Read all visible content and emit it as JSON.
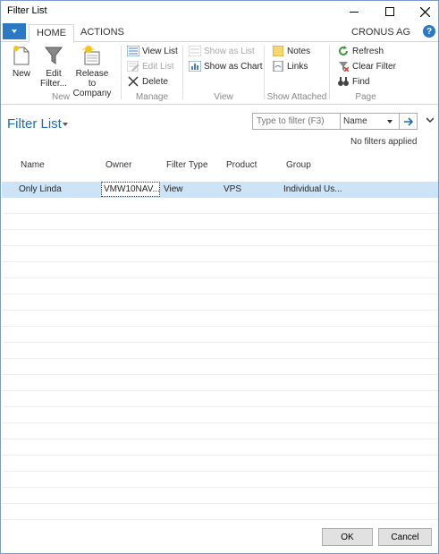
{
  "window": {
    "title": "Filter List"
  },
  "ribbon_tabs": {
    "home": "HOME",
    "actions": "ACTIONS",
    "company": "CRONUS AG"
  },
  "ribbon": {
    "new_group": {
      "label": "New",
      "new": "New",
      "edit_filter": [
        "Edit",
        "Filter..."
      ],
      "release": [
        "Release to",
        "Company"
      ]
    },
    "manage_group": {
      "label": "Manage",
      "view_list": "View List",
      "edit_list": "Edit List",
      "delete": "Delete"
    },
    "view_group": {
      "label": "View",
      "show_as_list": "Show as List",
      "show_as_chart": "Show as Chart"
    },
    "attached_group": {
      "label": "Show Attached",
      "notes": "Notes",
      "links": "Links"
    },
    "page_group": {
      "label": "Page",
      "refresh": "Refresh",
      "clear_filter": "Clear Filter",
      "find": "Find"
    }
  },
  "page": {
    "title": "Filter List",
    "filter_placeholder": "Type to filter (F3)",
    "filter_field": "Name",
    "no_filters": "No filters applied"
  },
  "table": {
    "columns": [
      "Name",
      "Owner",
      "Filter Type",
      "Product",
      "Group"
    ],
    "rows": [
      {
        "name": "Only Linda",
        "owner": "VMW10NAV...",
        "filter_type": "View",
        "product": "VPS",
        "group": "Individual Us..."
      }
    ]
  },
  "footer": {
    "ok": "OK",
    "cancel": "Cancel"
  },
  "colors": {
    "accent": "#2b78c5",
    "title": "#1e6bb8",
    "selection": "#cde4f7"
  }
}
